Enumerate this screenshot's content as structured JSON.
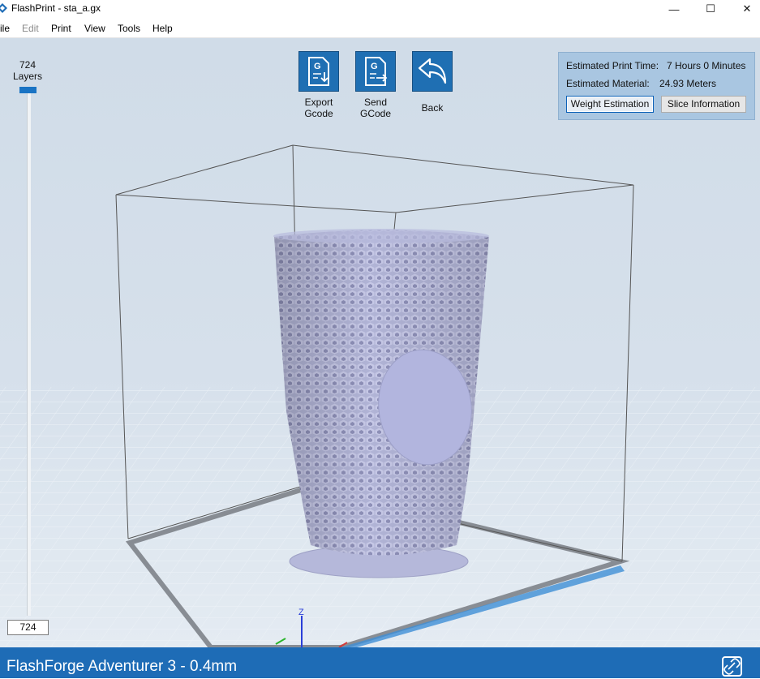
{
  "window": {
    "title": "FlashPrint - sta_a.gx",
    "controls": {
      "minimize": "—",
      "maximize": "☐",
      "close": "✕"
    }
  },
  "menu": {
    "items": [
      {
        "label": "ile",
        "enabled": true
      },
      {
        "label": "Edit",
        "enabled": false
      },
      {
        "label": "Print",
        "enabled": true
      },
      {
        "label": "View",
        "enabled": true
      },
      {
        "label": "Tools",
        "enabled": true
      },
      {
        "label": "Help",
        "enabled": true
      }
    ]
  },
  "layers": {
    "count": "724",
    "label": "Layers",
    "current": "724",
    "position_fraction": 1.0
  },
  "toolbar": {
    "export": {
      "line1": "Export",
      "line2": "Gcode",
      "icon": "export-gcode-icon"
    },
    "send": {
      "line1": "Send",
      "line2": "GCode",
      "icon": "send-gcode-icon"
    },
    "back": {
      "label": "Back",
      "icon": "back-arrow-icon"
    }
  },
  "info": {
    "print_time_label": "Estimated Print Time:",
    "print_time_value": "7 Hours 0 Minutes",
    "material_label": "Estimated Material:",
    "material_value": "24.93 Meters",
    "weight_button": "Weight Estimation",
    "slice_button": "Slice Information"
  },
  "axes": {
    "z": "Z"
  },
  "status": {
    "printer": "FlashForge Adventurer 3 - 0.4mm",
    "connection_icon": "connect-icon"
  },
  "colors": {
    "accent": "#1e6cb6",
    "model": "#b3b6d8",
    "info_panel": "#a9c6e1"
  }
}
